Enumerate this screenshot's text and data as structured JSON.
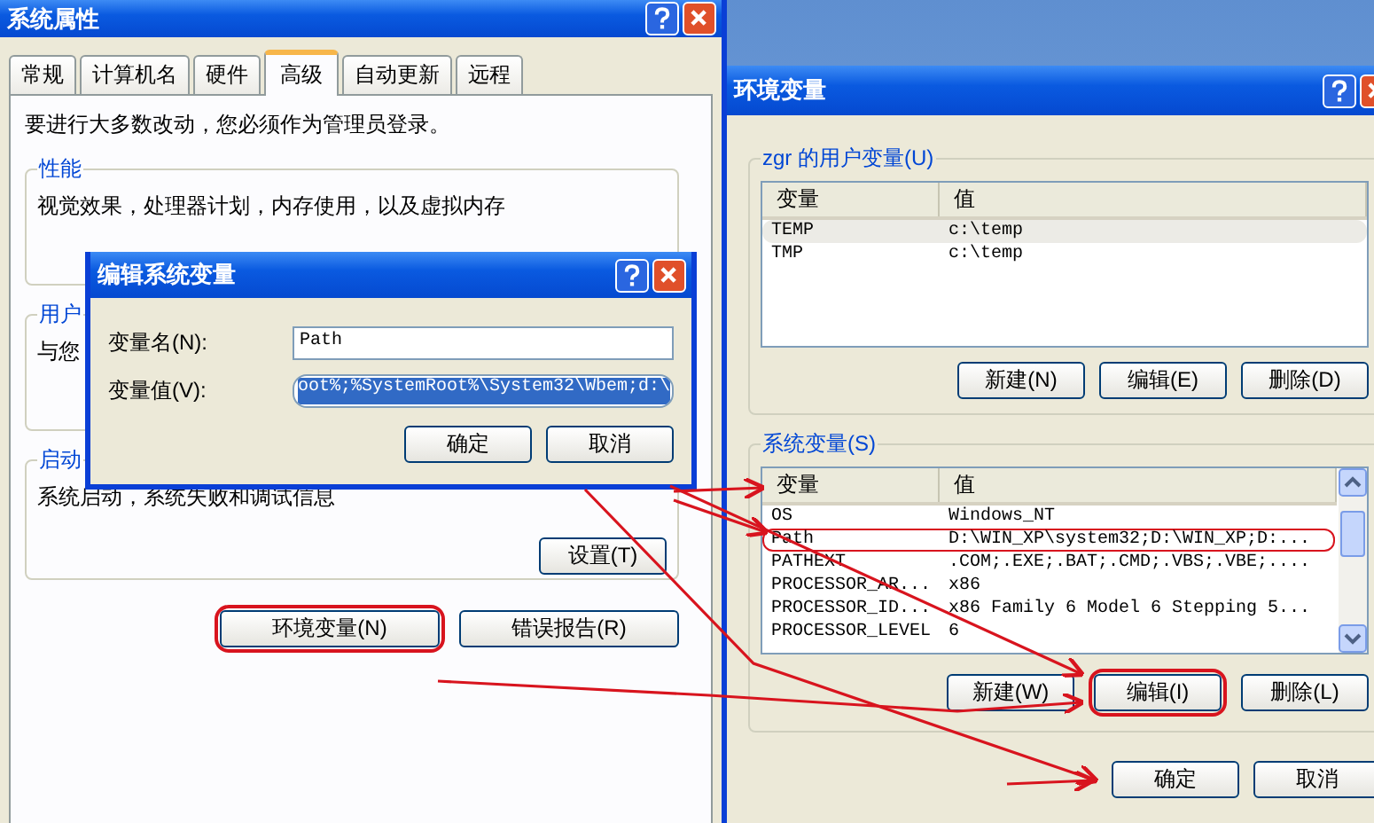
{
  "system_properties": {
    "title": "系统属性",
    "tabs": [
      {
        "label": "常规",
        "selected": false
      },
      {
        "label": "计算机名",
        "selected": false
      },
      {
        "label": "硬件",
        "selected": false
      },
      {
        "label": "高级",
        "selected": true
      },
      {
        "label": "自动更新",
        "selected": false
      },
      {
        "label": "远程",
        "selected": false
      }
    ],
    "admin_notice": "要进行大多数改动，您必须作为管理员登录。",
    "performance": {
      "label": "性能",
      "description": "视觉效果，处理器计划，内存使用，以及虚拟内存"
    },
    "user_profiles": {
      "label": "用户",
      "description": "与您"
    },
    "startup": {
      "label": "启动",
      "description": "系统启动，系统失败和调试信息",
      "button": "设置(T)"
    },
    "buttons": [
      {
        "label": "环境变量(N)",
        "circled": true
      },
      {
        "label": "错误报告(R)",
        "circled": false
      }
    ]
  },
  "environment_variables": {
    "title": "环境变量",
    "user_vars": {
      "label": "zgr 的用户变量(U)",
      "columns": [
        "变量",
        "值"
      ],
      "rows": [
        {
          "name": "TEMP",
          "value": "c:\\temp",
          "selected": true,
          "circled": false
        },
        {
          "name": "TMP",
          "value": "c:\\temp",
          "selected": false,
          "circled": false
        }
      ],
      "buttons": [
        {
          "label": "新建(N)",
          "circled": false
        },
        {
          "label": "编辑(E)",
          "circled": false
        },
        {
          "label": "删除(D)",
          "circled": false
        }
      ]
    },
    "system_vars": {
      "label": "系统变量(S)",
      "columns": [
        "变量",
        "值"
      ],
      "rows": [
        {
          "name": "OS",
          "value": "Windows_NT",
          "selected": false,
          "circled": false
        },
        {
          "name": "Path",
          "value": "D:\\WIN_XP\\system32;D:\\WIN_XP;D:...",
          "selected": false,
          "circled": true
        },
        {
          "name": "PATHEXT",
          "value": ".COM;.EXE;.BAT;.CMD;.VBS;.VBE;....",
          "selected": false,
          "circled": false
        },
        {
          "name": "PROCESSOR_AR...",
          "value": "x86",
          "selected": false,
          "circled": false
        },
        {
          "name": "PROCESSOR_ID...",
          "value": "x86 Family 6 Model 6 Stepping 5...",
          "selected": false,
          "circled": false
        },
        {
          "name": "PROCESSOR_LEVEL",
          "value": "6",
          "selected": false,
          "circled": false
        }
      ],
      "buttons": [
        {
          "label": "新建(W)",
          "circled": false
        },
        {
          "label": "编辑(I)",
          "circled": true
        },
        {
          "label": "删除(L)",
          "circled": false
        }
      ]
    },
    "buttons": [
      {
        "label": "确定",
        "circled": false
      },
      {
        "label": "取消",
        "circled": false
      }
    ]
  },
  "edit_dialog": {
    "title": "编辑系统变量",
    "name_label": "变量名(N):",
    "name_value": "Path",
    "value_label": "变量值(V):",
    "value_value": "oot%;%SystemRoot%\\System32\\Wbem;d:\\",
    "value_circled": true,
    "buttons": [
      {
        "label": "确定",
        "circled": false
      },
      {
        "label": "取消",
        "circled": false
      }
    ]
  }
}
